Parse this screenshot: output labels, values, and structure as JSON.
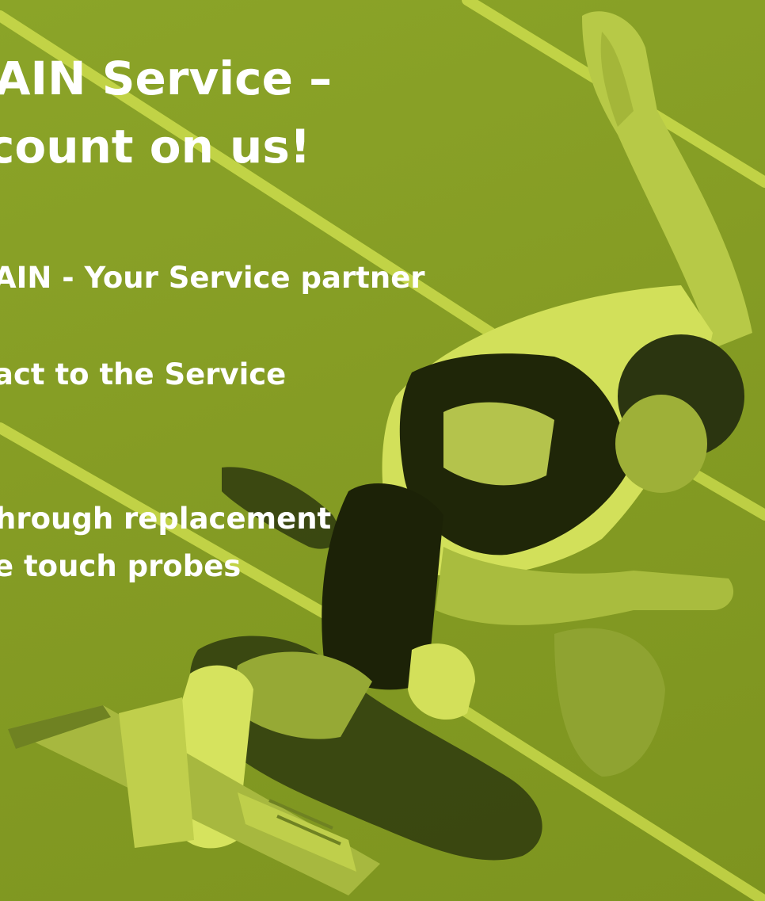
{
  "slide": {
    "headline_line1": "IAIN Service –",
    "headline_line2": "count on us!",
    "bullet_1": "AIN - Your Service partner",
    "bullet_2": "act to the Service",
    "bullet_3_line1": "hrough replacement",
    "bullet_3_line2": "e touch probes"
  },
  "colors": {
    "background_green": "#839a22",
    "track_lines": "#c8d84a",
    "text": "#ffffff"
  },
  "photo": {
    "subject": "sprinter-on-starting-block-photo",
    "tint": "lime-green duotone"
  }
}
